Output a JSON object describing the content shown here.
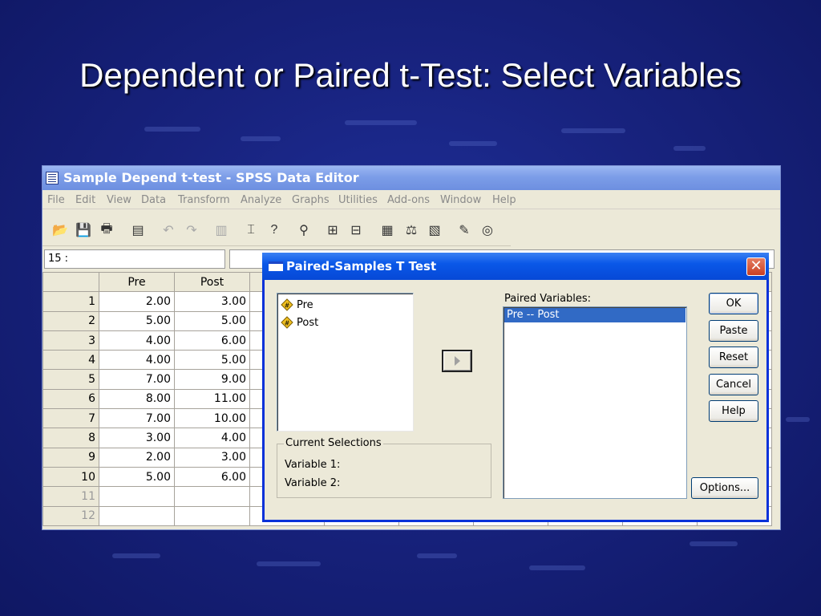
{
  "slide": {
    "title": "Dependent or Paired t-Test: Select Variables"
  },
  "window": {
    "title": "Sample Depend t-test - SPSS Data Editor",
    "menu": [
      "File",
      "Edit",
      "View",
      "Data",
      "Transform",
      "Analyze",
      "Graphs",
      "Utilities",
      "Add-ons",
      "Window",
      "Help"
    ],
    "toolbar_icons": [
      "open-icon",
      "save-icon",
      "print-icon",
      "dialog-recall-icon",
      "undo-icon",
      "redo-icon",
      "goto-chart-icon",
      "goto-case-icon",
      "variables-icon",
      "find-icon",
      "insert-cases-icon",
      "insert-variable-icon",
      "split-file-icon",
      "weight-cases-icon",
      "select-cases-icon",
      "value-labels-icon",
      "use-sets-icon"
    ],
    "cell_ref": "15 :",
    "columns": [
      "Pre",
      "Post"
    ],
    "rows": [
      {
        "n": "1",
        "pre": "2.00",
        "post": "3.00"
      },
      {
        "n": "2",
        "pre": "5.00",
        "post": "5.00"
      },
      {
        "n": "3",
        "pre": "4.00",
        "post": "6.00"
      },
      {
        "n": "4",
        "pre": "4.00",
        "post": "5.00"
      },
      {
        "n": "5",
        "pre": "7.00",
        "post": "9.00"
      },
      {
        "n": "6",
        "pre": "8.00",
        "post": "11.00"
      },
      {
        "n": "7",
        "pre": "7.00",
        "post": "10.00"
      },
      {
        "n": "8",
        "pre": "3.00",
        "post": "4.00"
      },
      {
        "n": "9",
        "pre": "2.00",
        "post": "3.00"
      },
      {
        "n": "10",
        "pre": "5.00",
        "post": "6.00"
      },
      {
        "n": "11",
        "pre": "",
        "post": ""
      },
      {
        "n": "12",
        "pre": "",
        "post": ""
      }
    ]
  },
  "dialog": {
    "title": "Paired-Samples T Test",
    "close_label": "✕",
    "variables": [
      "Pre",
      "Post"
    ],
    "paired_label": "Paired Variables:",
    "paired_items": [
      "Pre -- Post"
    ],
    "current_selections": {
      "legend": "Current Selections",
      "var1": "Variable 1:",
      "var2": "Variable 2:"
    },
    "buttons": {
      "ok": "OK",
      "paste": "Paste",
      "reset": "Reset",
      "cancel": "Cancel",
      "help": "Help",
      "options": "Options..."
    }
  },
  "colors": {
    "slide_bg": "#18237f",
    "dialog_title": "#0a58e8",
    "selection": "#316ac5"
  }
}
